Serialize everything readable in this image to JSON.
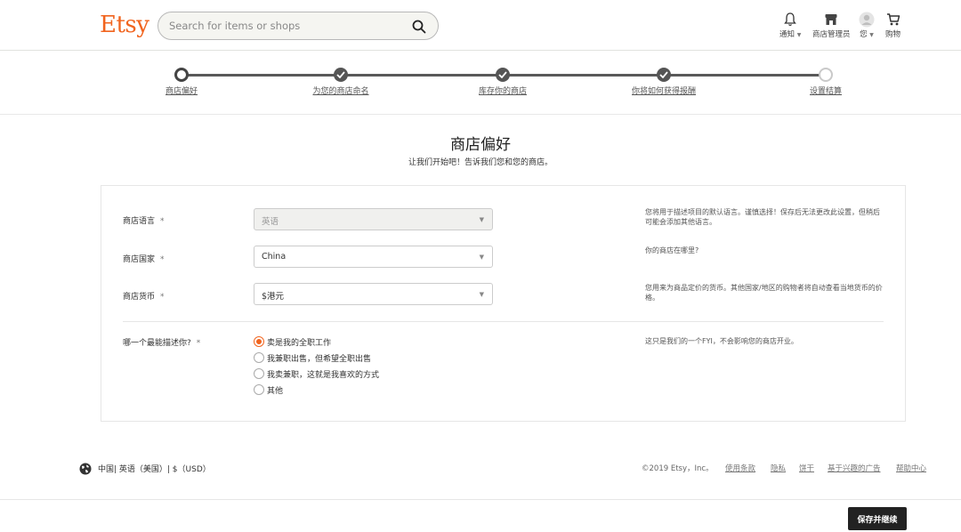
{
  "header": {
    "logo": "Etsy",
    "search_placeholder": "Search for items or shops",
    "nav": {
      "notifications": "通知",
      "shop_manager": "商店管理员",
      "you": "您",
      "cart": "购物"
    }
  },
  "steps": [
    {
      "label": "商店偏好",
      "state": "current"
    },
    {
      "label": "为您的商店命名",
      "state": "done"
    },
    {
      "label": "库存你的商店",
      "state": "done"
    },
    {
      "label": "你将如何获得报酬",
      "state": "done"
    },
    {
      "label": "设置结算",
      "state": "future"
    }
  ],
  "page": {
    "title": "商店偏好",
    "subtitle": "让我们开始吧！告诉我们您和您的商店。"
  },
  "form": {
    "required_mark": "*",
    "language": {
      "label": "商店语言",
      "value": "英语",
      "help": "您将用于描述项目的默认语言。谨慎选择！保存后无法更改此设置，但稍后可能会添加其他语言。"
    },
    "country": {
      "label": "商店国家",
      "value": "China",
      "help": "你的商店在哪里?"
    },
    "currency": {
      "label": "商店货币",
      "value": "$港元",
      "help": "您用来为商品定价的货币。其他国家/地区的购物者将自动查看当地货币的价格。"
    },
    "describe": {
      "label": "哪一个最能描述你?",
      "help": "这只是我们的一个FYI，不会影响您的商店开业。",
      "options": [
        {
          "label": "卖是我的全职工作",
          "checked": true
        },
        {
          "label": "我兼职出售，但希望全职出售",
          "checked": false
        },
        {
          "label": "我卖兼职，这就是我喜欢的方式",
          "checked": false
        },
        {
          "label": "其他",
          "checked": false
        }
      ]
    }
  },
  "footer": {
    "locale": "中国| 英语（美国）| $（USD）",
    "copyright": "©2019 Etsy，Inc。",
    "links": [
      "使用条款",
      "隐私",
      "饼干",
      "基于兴趣的广告",
      "帮助中心"
    ]
  },
  "action": {
    "save_label": "保存并继续"
  },
  "colors": {
    "brand": "#f1641e",
    "button_bg": "#222222"
  }
}
